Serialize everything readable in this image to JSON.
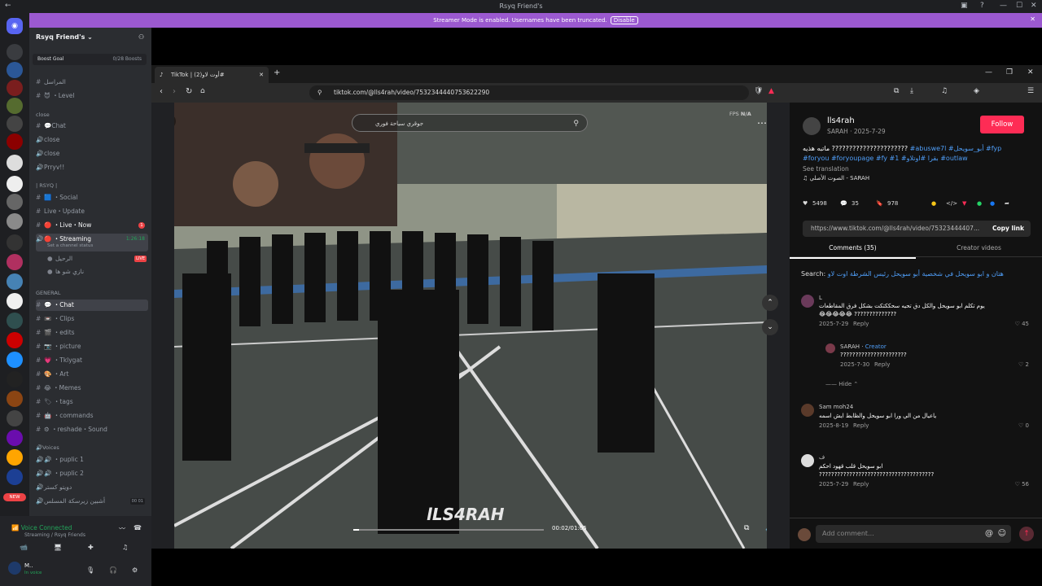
{
  "window": {
    "title": "Rsyq Friend's"
  },
  "banner": {
    "message": "Streamer Mode is enabled. Usernames have been truncated.",
    "disable": "Disable"
  },
  "server": {
    "name": "Rsyq Friend's",
    "boost_goal": "Boost Goal",
    "boosts": "0/28 Boosts"
  },
  "channels": {
    "top": [
      {
        "label": "المراسل"
      },
      {
        "label": "Level"
      }
    ],
    "close_cat": "close",
    "close": [
      {
        "label": "Chat"
      },
      {
        "label": "close"
      },
      {
        "label": "close"
      },
      {
        "label": "Prryv!!"
      }
    ],
    "rsyq_cat": "| RSYQ |",
    "rsyq": [
      {
        "label": "Social"
      },
      {
        "label": "Live・Update"
      },
      {
        "label": "Live・Now",
        "badge": "1"
      },
      {
        "label": "Streaming",
        "time": "1:26:18",
        "sub": "Set a channel status"
      },
      {
        "label": "الرحيل",
        "live": "LIVE"
      },
      {
        "label": "نازي شو ها"
      }
    ],
    "general_cat": "GENERAL",
    "general": [
      {
        "label": "Chat"
      },
      {
        "label": "Clips"
      },
      {
        "label": "edits"
      },
      {
        "label": "picture"
      },
      {
        "label": "Tklygat"
      },
      {
        "label": "Art"
      },
      {
        "label": "Memes"
      },
      {
        "label": "tags"
      },
      {
        "label": "commands"
      },
      {
        "label": "reshade・Sound"
      }
    ],
    "voices_cat": "Voices",
    "voices": [
      {
        "label": "puplic 1"
      },
      {
        "label": "puplic 2"
      },
      {
        "label": "دويتو كستر"
      },
      {
        "label": "أشبين زيرسكة المسلس",
        "count": "00",
        "count2": "01"
      }
    ]
  },
  "voice": {
    "status": "Voice Connected",
    "where": "Streaming / Rsyq Friends"
  },
  "user": {
    "name": "M..",
    "status": "In voice",
    "new_badge": "NEW"
  },
  "browser": {
    "tab_title": "TikTok | أوت لاو(2)#",
    "url": "tiktok.com/@lls4rah/video/7532344440753622290"
  },
  "video": {
    "search_text": "جوقري سياحة فوري",
    "fps_label": "FPS",
    "fps_value": "N/A",
    "watermark": "lLS4RAH",
    "time": "00:02/01:05",
    "progress": 0.03
  },
  "post": {
    "username": "lls4rah",
    "author": "SARAH",
    "date": "2025-7-29",
    "follow": "Follow",
    "caption_line1": "ماتبه هذيه ??????????????????????",
    "hashtags_line1": "#abuswe7l #أبو_سويحل #fyp",
    "hashtags_line2": "#foryou #foryoupage #fy #1 #بقرا #اوتلاو #outlaw",
    "see_translation": "See translation",
    "sound": "الصوت الأصلي - SARAH",
    "likes": "5498",
    "comments": "35",
    "saves": "978",
    "share_url": "https://www.tiktok.com/@lls4rah/video/75323444407...",
    "copy_link": "Copy link",
    "tab_comments": "Comments (35)",
    "tab_creator": "Creator videos",
    "search_prefix": "Search:",
    "search_query": "هتان و ابو سويحل في شخصية أبو سويحل رئيس الشرطة اوت لاو",
    "add_comment": "Add comment..."
  },
  "comments": [
    {
      "user": "L",
      "text": "يوم تكلم ابو سويحل والكل دق تحيه سحككتكت بشكل فرق المقاطعات",
      "emoji": "😂😂😂😂😂 ??????????????",
      "date": "2025-7-29",
      "reply": "Reply",
      "likes": "45"
    },
    {
      "user": "SARAH",
      "creator": "Creator",
      "text": "??????????????????????",
      "date": "2025-7-30",
      "reply": "Reply",
      "likes": "2"
    },
    {
      "hide": "Hide"
    },
    {
      "user": "Sam moh24",
      "text": "ياعيال من الي ورا ابو سويحل والظابط ايش اسمه",
      "date": "2025-8-19",
      "reply": "Reply",
      "likes": "0"
    },
    {
      "user": "ف",
      "text": "ابو سويحل قلب قهود احكم",
      "text2": "??????????????????????????????????????",
      "date": "2025-7-29",
      "reply": "Reply",
      "likes": "56"
    }
  ],
  "colors": {
    "accent": "#fe2c55",
    "discord_purple": "#9b59d0",
    "live_red": "#ed4245",
    "link_blue": "#4f9ef8"
  }
}
